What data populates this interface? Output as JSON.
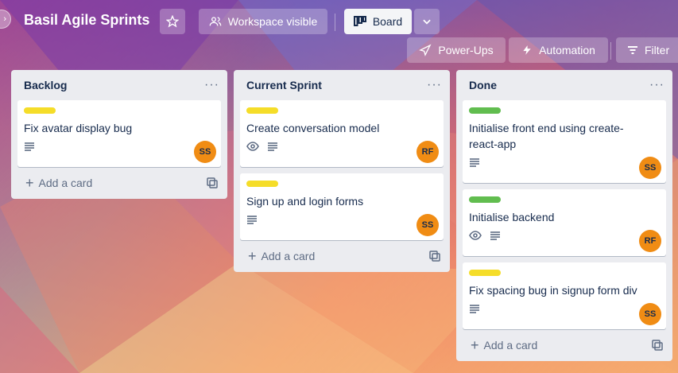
{
  "header": {
    "board_title": "Basil Agile Sprints",
    "workspace_label": "Workspace visible",
    "board_view_label": "Board",
    "powerups_label": "Power-Ups",
    "automation_label": "Automation",
    "filter_label": "Filter"
  },
  "colors": {
    "label_yellow": "#f5dd29",
    "label_green": "#61bd4f",
    "member_orange": "#f08c14",
    "list_bg": "#ebecf0"
  },
  "lists": [
    {
      "title": "Backlog",
      "add_label": "Add a card",
      "cards": [
        {
          "label_color": "yellow",
          "title": "Fix avatar display bug",
          "badges": [
            "description-icon"
          ],
          "member": "SS"
        }
      ]
    },
    {
      "title": "Current Sprint",
      "add_label": "Add a card",
      "cards": [
        {
          "label_color": "yellow",
          "title": "Create conversation model",
          "badges": [
            "watch-icon",
            "description-icon"
          ],
          "member": "RF"
        },
        {
          "label_color": "yellow",
          "title": "Sign up and login forms",
          "badges": [
            "description-icon"
          ],
          "member": "SS"
        }
      ]
    },
    {
      "title": "Done",
      "add_label": "Add a card",
      "cards": [
        {
          "label_color": "green",
          "title": "Initialise front end using create-react-app",
          "badges": [
            "description-icon"
          ],
          "member": "SS"
        },
        {
          "label_color": "green",
          "title": "Initialise backend",
          "badges": [
            "watch-icon",
            "description-icon"
          ],
          "member": "RF"
        },
        {
          "label_color": "yellow",
          "title": "Fix spacing bug in signup form div",
          "badges": [
            "description-icon"
          ],
          "member": "SS"
        }
      ]
    }
  ]
}
